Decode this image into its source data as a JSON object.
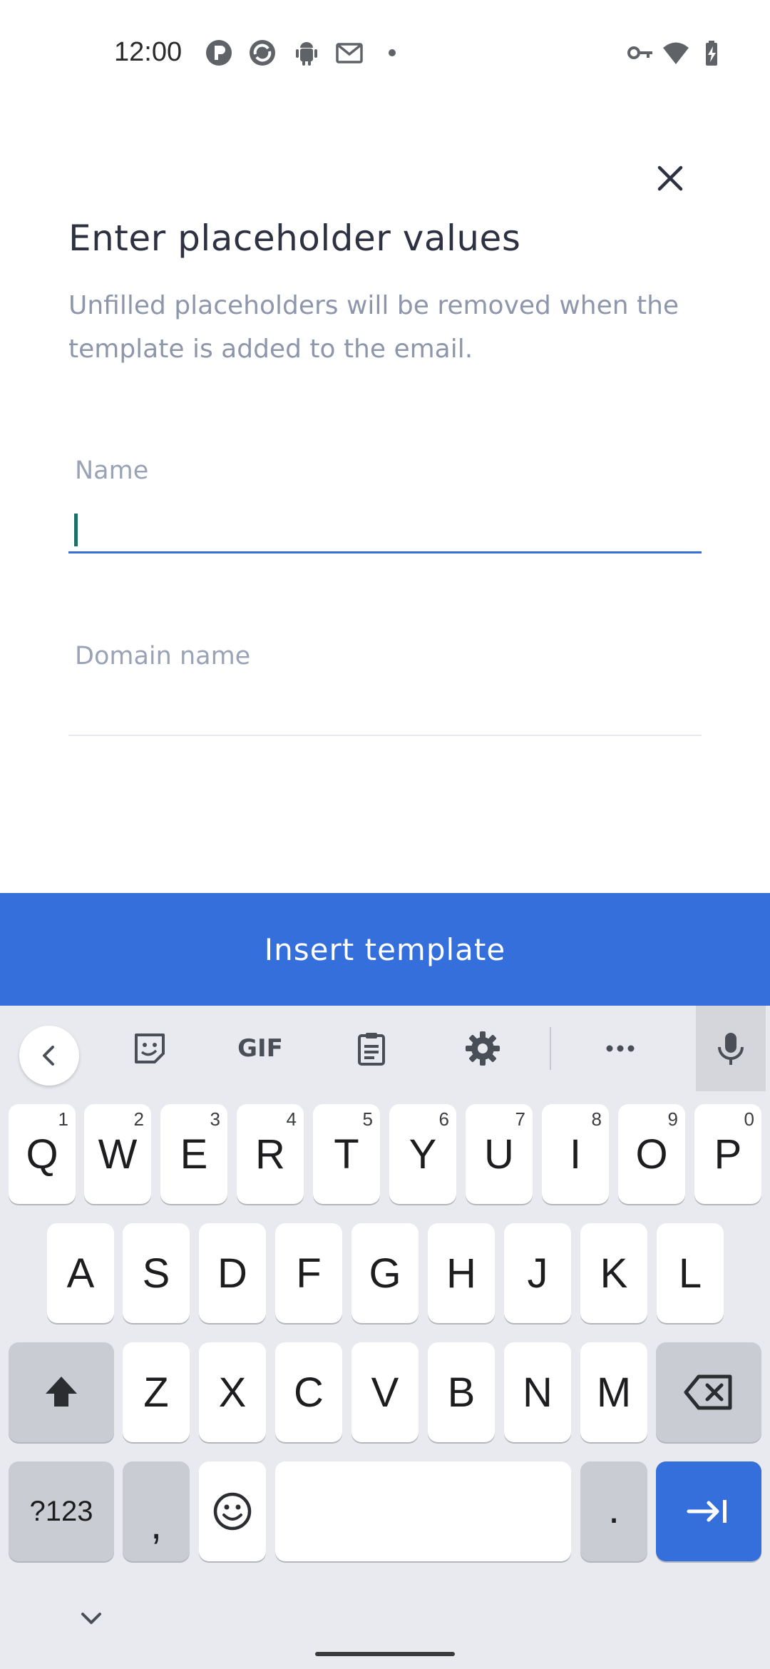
{
  "status_bar": {
    "time": "12:00",
    "left_icons": [
      "app-p-icon",
      "app-circle-icon",
      "android-icon",
      "gmail-icon",
      "dot-icon"
    ],
    "right_icons": [
      "vpn-key-icon",
      "wifi-icon",
      "battery-charging-icon"
    ]
  },
  "dialog": {
    "title": "Enter placeholder values",
    "subtitle": "Unfilled placeholders will be removed when the template is added to the email.",
    "fields": [
      {
        "label": "Name",
        "value": "",
        "focused": true
      },
      {
        "label": "Domain name",
        "value": "",
        "focused": false
      }
    ],
    "insert_button": "Insert template"
  },
  "colors": {
    "accent": "#346fdb",
    "title": "#2d3142",
    "muted": "#8d96ab",
    "caret": "#1f6f66"
  },
  "keyboard": {
    "toolbar": [
      "back-icon",
      "sticker-icon",
      "GIF",
      "clipboard-icon",
      "settings-icon",
      "more-icon",
      "mic-icon"
    ],
    "gif_label": "GIF",
    "row1": [
      {
        "label": "Q",
        "hint": "1"
      },
      {
        "label": "W",
        "hint": "2"
      },
      {
        "label": "E",
        "hint": "3"
      },
      {
        "label": "R",
        "hint": "4"
      },
      {
        "label": "T",
        "hint": "5"
      },
      {
        "label": "Y",
        "hint": "6"
      },
      {
        "label": "U",
        "hint": "7"
      },
      {
        "label": "I",
        "hint": "8"
      },
      {
        "label": "O",
        "hint": "9"
      },
      {
        "label": "P",
        "hint": "0"
      }
    ],
    "row2": [
      "A",
      "S",
      "D",
      "F",
      "G",
      "H",
      "J",
      "K",
      "L"
    ],
    "row3": [
      "Z",
      "X",
      "C",
      "V",
      "B",
      "N",
      "M"
    ],
    "symbols_key": "?123",
    "comma_key": ",",
    "period_key": "."
  }
}
